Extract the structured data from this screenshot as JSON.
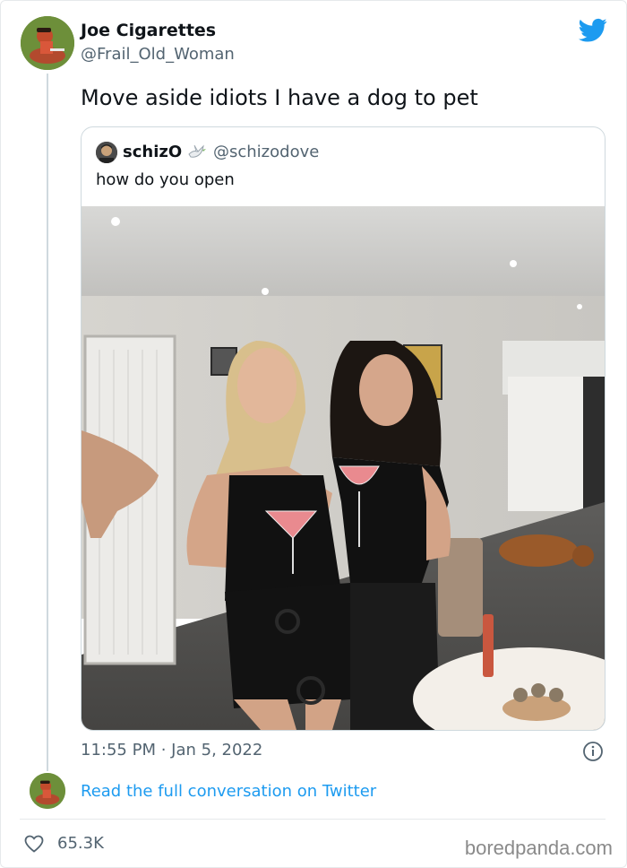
{
  "tweet": {
    "author_name": "Joe Cigarettes",
    "author_handle": "@Frail_Old_Woman",
    "text": "Move aside idiots I have a dog to pet",
    "timestamp": "11:55 PM · Jan 5, 2022",
    "likes": "65.3K",
    "read_more": "Read the full conversation on Twitter"
  },
  "quote": {
    "author_name": "schizO",
    "author_handle": "@schizodove",
    "text": "how do you open"
  },
  "icons": {
    "brand": "twitter-bird-icon",
    "info": "info-icon",
    "like": "heart-icon",
    "badge": "dove-emoji"
  },
  "colors": {
    "accent": "#1d9bf0",
    "text_primary": "#0f1419",
    "text_secondary": "#536471",
    "border": "#cfd9de"
  },
  "watermark": "boredpanda.com"
}
